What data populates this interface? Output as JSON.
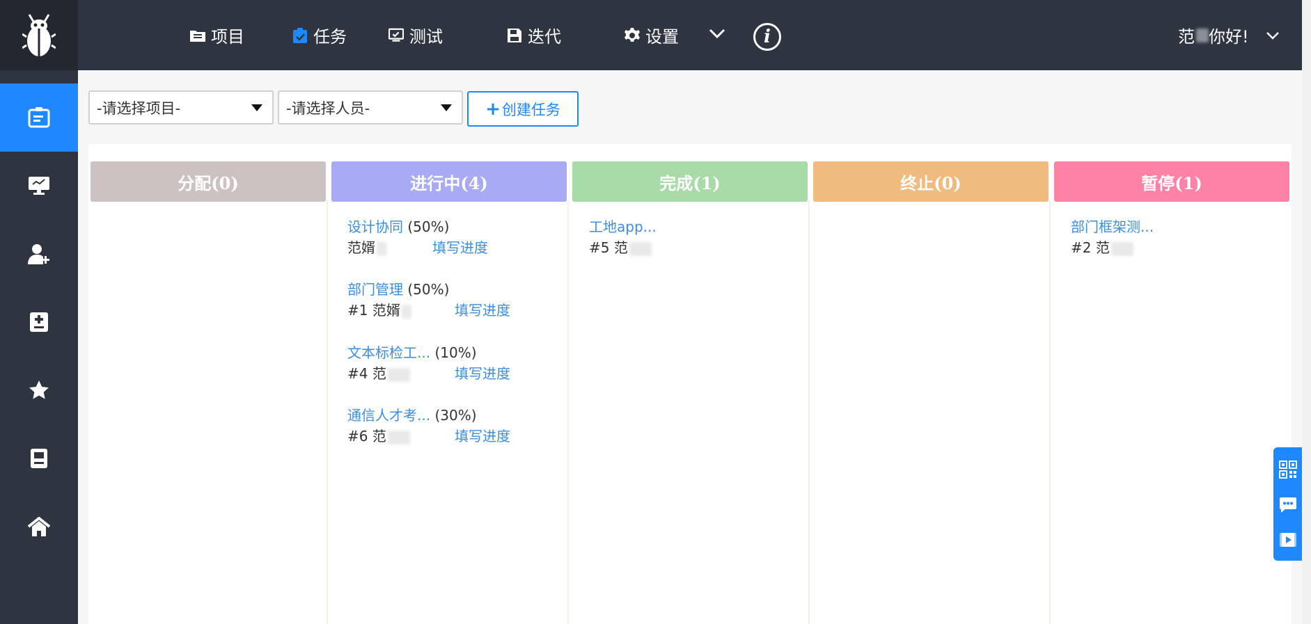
{
  "header": {
    "nav": [
      {
        "label": "项目",
        "icon": "folder-icon"
      },
      {
        "label": "任务",
        "icon": "clipboard-icon"
      },
      {
        "label": "测试",
        "icon": "monitor-check-icon"
      },
      {
        "label": "迭代",
        "icon": "save-icon"
      },
      {
        "label": "设置",
        "icon": "gear-icon"
      }
    ],
    "active_nav": "任务",
    "user_greeting": "你好!",
    "user_name": "范"
  },
  "sidebar": {
    "items": [
      {
        "icon": "task-board-icon",
        "active": true
      },
      {
        "icon": "monitor-icon"
      },
      {
        "icon": "add-user-icon"
      },
      {
        "icon": "document-plus-minus-icon"
      },
      {
        "icon": "star-icon"
      },
      {
        "icon": "contact-card-icon"
      },
      {
        "icon": "home-icon"
      }
    ]
  },
  "filters": {
    "project_select": "-请选择项目-",
    "person_select": "-请选择人员-",
    "create_button": "创建任务"
  },
  "colors": {
    "accent": "#1e88ff",
    "topbar": "#2e3440",
    "link": "#3a8ee6"
  },
  "columns": [
    {
      "title": "分配(0)",
      "color": "#cdc2c2",
      "cards": []
    },
    {
      "title": "进行中(4)",
      "color": "#a9aaf4",
      "cards": [
        {
          "name": "设计协同",
          "progress": "(50%)",
          "id": "",
          "owner": "范婿",
          "action": "填写进度"
        },
        {
          "name": "部门管理",
          "progress": "(50%)",
          "id": "#1",
          "owner": "范婿",
          "action": "填写进度"
        },
        {
          "name": "文本标检工...",
          "progress": "(10%)",
          "id": "#4",
          "owner": "范",
          "action": "填写进度"
        },
        {
          "name": "通信人才考...",
          "progress": "(30%)",
          "id": "#6",
          "owner": "范",
          "action": "填写进度"
        }
      ]
    },
    {
      "title": "完成(1)",
      "color": "#a8dba8",
      "cards": [
        {
          "name": "工地app...",
          "progress": "",
          "id": "#5",
          "owner": "范",
          "action": ""
        }
      ]
    },
    {
      "title": "终止(0)",
      "color": "#f0bb7e",
      "cards": []
    },
    {
      "title": "暂停(1)",
      "color": "#fd82a6",
      "cards": [
        {
          "name": "部门框架测...",
          "progress": "",
          "id": "#2",
          "owner": "范",
          "action": ""
        }
      ]
    }
  ],
  "float_toolbar": {
    "icons": [
      "qr-code-icon",
      "chat-icon",
      "video-icon"
    ]
  }
}
